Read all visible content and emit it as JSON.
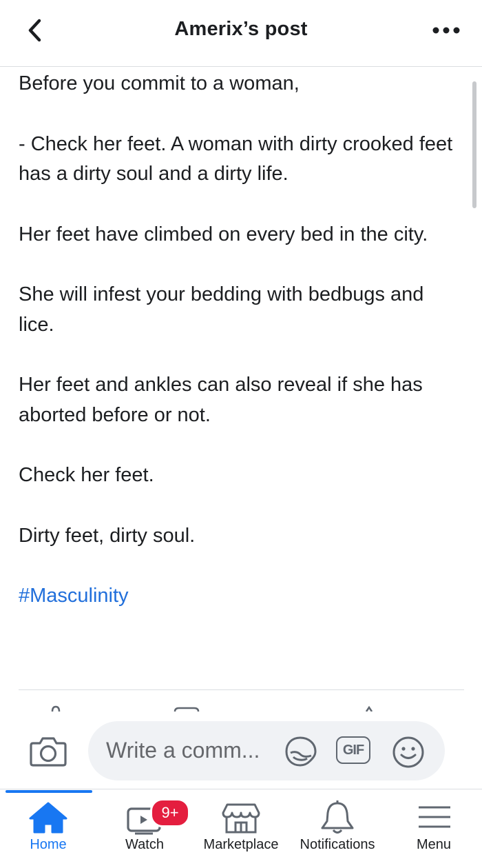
{
  "header": {
    "title": "Amerix’s post"
  },
  "post": {
    "paragraphs": [
      "Before you commit to a woman,",
      "- Check her feet. A woman with dirty crooked feet has a dirty soul and a dirty life.",
      "Her feet have climbed on every bed in the city.",
      "She will infest your bedding with bedbugs and lice.",
      "Her feet and ankles can also reveal if she has aborted before or not.",
      "Check her feet.",
      "Dirty feet, dirty soul."
    ],
    "hashtag": "#Masculinity"
  },
  "comment_bar": {
    "placeholder": "Write a comm...",
    "gif_label": "GIF"
  },
  "tabbar": {
    "tabs": [
      {
        "label": "Home",
        "icon": "home-icon",
        "active": true
      },
      {
        "label": "Watch",
        "icon": "watch-icon",
        "badge": "9+"
      },
      {
        "label": "Marketplace",
        "icon": "marketplace-icon"
      },
      {
        "label": "Notifications",
        "icon": "bell-icon"
      },
      {
        "label": "Menu",
        "icon": "menu-icon"
      }
    ]
  },
  "colors": {
    "accent": "#1877f2",
    "hashtag": "#216fdb",
    "badge": "#e41e3f"
  }
}
